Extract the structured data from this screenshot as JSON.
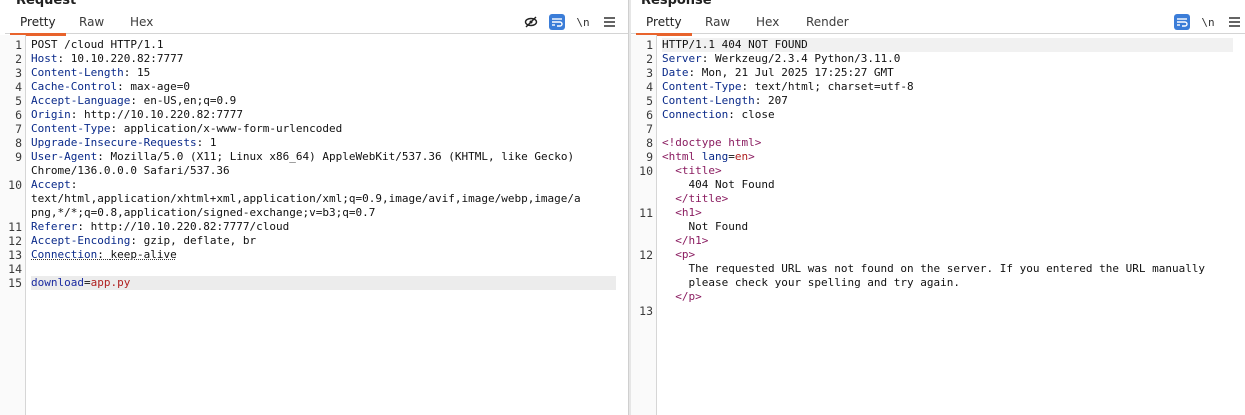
{
  "request": {
    "title": "Request",
    "tabs": [
      "Pretty",
      "Raw",
      "Hex"
    ],
    "active_tab": "Pretty",
    "icons": [
      "eye-slash-icon",
      "wrap-icon",
      "newline-icon",
      "menu-icon"
    ],
    "newline_label": "\\n",
    "lines": {
      "l1": "POST /cloud HTTP/1.1",
      "l2k": "Host",
      "l2v": "10.10.220.82:7777",
      "l3k": "Content-Length",
      "l3v": "15",
      "l4k": "Cache-Control",
      "l4v": "max-age=0",
      "l5k": "Accept-Language",
      "l5v": "en-US,en;q=0.9",
      "l6k": "Origin",
      "l6v": "http://10.10.220.82:7777",
      "l7k": "Content-Type",
      "l7v": "application/x-www-form-urlencoded",
      "l8k": "Upgrade-Insecure-Requests",
      "l8v": "1",
      "l9k": "User-Agent",
      "l9v": "Mozilla/5.0 (X11; Linux x86_64) AppleWebKit/537.36 (KHTML, like Gecko)",
      "l9c": "Chrome/136.0.0.0 Safari/537.36",
      "l10k": "Accept",
      "l10c1": "text/html,application/xhtml+xml,application/xml;q=0.9,image/avif,image/webp,image/a",
      "l10c2": "png,*/*;q=0.8,application/signed-exchange;v=b3;q=0.7",
      "l11k": "Referer",
      "l11v": "http://10.10.220.82:7777/cloud",
      "l12k": "Accept-Encoding",
      "l12v": "gzip, deflate, br",
      "l13k": "Connection",
      "l13v": "keep-alive",
      "l15k": "download",
      "l15v": "app.py"
    }
  },
  "response": {
    "title": "Response",
    "tabs": [
      "Pretty",
      "Raw",
      "Hex",
      "Render"
    ],
    "active_tab": "Pretty",
    "icons": [
      "wrap-icon",
      "newline-icon",
      "menu-icon"
    ],
    "newline_label": "\\n",
    "lines": {
      "l1": "HTTP/1.1 404 NOT FOUND",
      "l2k": "Server",
      "l2v": "Werkzeug/2.3.4 Python/3.11.0",
      "l3k": "Date",
      "l3v": "Mon, 21 Jul 2025 17:25:27 GMT",
      "l4k": "Content-Type",
      "l4v": "text/html; charset=utf-8",
      "l5k": "Content-Length",
      "l5v": "207",
      "l6k": "Connection",
      "l6v": "close",
      "l8": "<!doctype html>",
      "l9tag": "<html",
      "l9attr": "lang",
      "l9val": "en",
      "l9end": ">",
      "l10open": "<title>",
      "l10text": "404 Not Found",
      "l10close": "</title>",
      "l11open": "<h1>",
      "l11text": "Not Found",
      "l11close": "</h1>",
      "l12open": "<p>",
      "l12text1": "The requested URL was not found on the server. If you entered the URL manually",
      "l12text2": "please check your spelling and try again.",
      "l12close": "</p>"
    }
  }
}
